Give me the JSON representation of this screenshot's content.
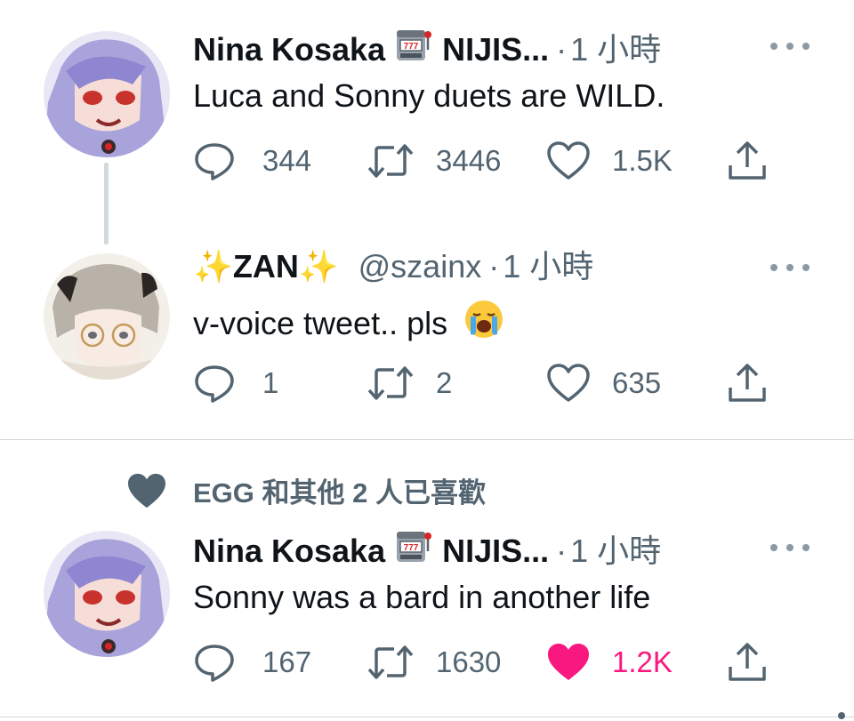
{
  "tweets": [
    {
      "name_left": "Nina Kosaka",
      "name_right": "NIJIS...",
      "handle": "",
      "dot": "·",
      "time": "1 小時",
      "text": "Luca and Sonny duets are WILD.",
      "replies": "344",
      "retweets": "3446",
      "likes": "1.5K",
      "liked": false,
      "emoji_icon": "slot-machine-icon"
    },
    {
      "name": "✨ZAN✨",
      "handle": "@szainx",
      "dot": "·",
      "time": "1 小時",
      "text": "v-voice tweet.. pls",
      "text_emoji": "loudly-crying-face-icon",
      "replies": "1",
      "retweets": "2",
      "likes": "635",
      "liked": false
    },
    {
      "name_left": "Nina Kosaka",
      "name_right": "NIJIS...",
      "handle": "",
      "dot": "·",
      "time": "1 小時",
      "text": "Sonny was a bard in another life",
      "replies": "167",
      "retweets": "1630",
      "likes": "1.2K",
      "liked": true,
      "emoji_icon": "slot-machine-icon"
    }
  ],
  "social_context": {
    "label": "EGG 和其他 2 人已喜歡",
    "icon": "heart-filled-icon"
  },
  "colors": {
    "text_primary": "#0f1419",
    "text_secondary": "#536471",
    "like_active": "#f91880",
    "divider": "#cfd9de"
  }
}
